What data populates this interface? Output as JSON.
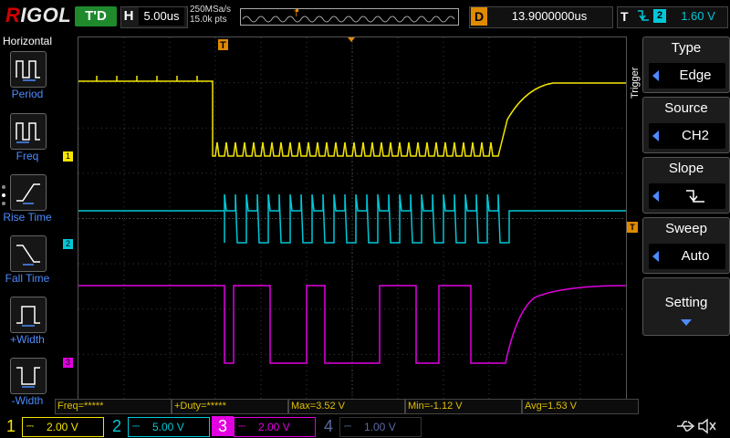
{
  "brand": {
    "logo": "RIGOL"
  },
  "top": {
    "trigger_status": "T'D",
    "timebase_label": "H",
    "timebase_value": "5.00us",
    "sample_rate": "250MSa/s",
    "memory_depth": "15.0k pts",
    "delay_label": "D",
    "delay_value": "13.9000000us",
    "trigger_label": "T",
    "trigger_source": "2",
    "trigger_level": "1.60 V"
  },
  "left_menu": {
    "title": "Horizontal",
    "items": [
      {
        "label": "Period",
        "icon": "period-icon"
      },
      {
        "label": "Freq",
        "icon": "freq-icon"
      },
      {
        "label": "Rise Time",
        "icon": "rise-time-icon"
      },
      {
        "label": "Fall Time",
        "icon": "fall-time-icon"
      },
      {
        "label": "+Width",
        "icon": "pos-width-icon"
      },
      {
        "label": "-Width",
        "icon": "neg-width-icon"
      }
    ]
  },
  "right_menu": {
    "title": "Trigger",
    "type": {
      "title": "Type",
      "value": "Edge"
    },
    "source": {
      "title": "Source",
      "value": "CH2"
    },
    "slope": {
      "title": "Slope",
      "icon": "falling-edge-icon"
    },
    "sweep": {
      "title": "Sweep",
      "value": "Auto"
    },
    "setting": {
      "title": "Setting"
    }
  },
  "markers": {
    "ch1": "1",
    "ch2": "2",
    "ch3": "3",
    "trigger_pos": "T",
    "trigger_level": "T"
  },
  "measurements": [
    {
      "text": "Freq=*****"
    },
    {
      "text": "+Duty=*****"
    },
    {
      "text": "Max=3.52 V"
    },
    {
      "text": "Min=-1.12 V"
    },
    {
      "text": "Avg=1.53 V"
    }
  ],
  "channels": [
    {
      "num": "1",
      "scale": "2.00 V",
      "color": "#f5e600",
      "active": true
    },
    {
      "num": "2",
      "scale": "5.00 V",
      "color": "#00c8d8",
      "active": true
    },
    {
      "num": "3",
      "scale": "2.00 V",
      "color": "#e000e0",
      "active": true,
      "selected": true
    },
    {
      "num": "4",
      "scale": "1.00 V",
      "color": "#5a6aa0",
      "active": false
    }
  ],
  "colors": {
    "ch1": "#f5e600",
    "ch2": "#00c8d8",
    "ch3": "#e000e0",
    "accent": "#4d8bff",
    "trigger": "#e08a00"
  }
}
